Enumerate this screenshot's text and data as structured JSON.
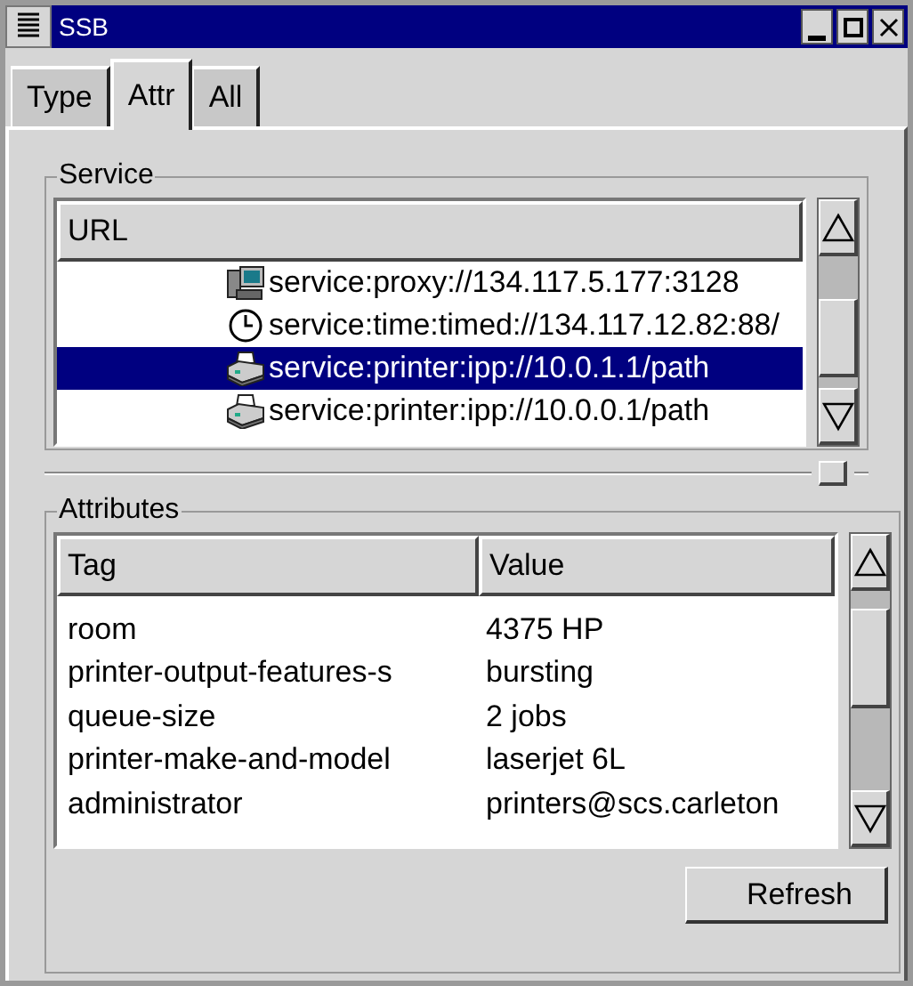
{
  "window": {
    "title": "SSB"
  },
  "tabs": [
    {
      "label": "Type",
      "selected": false
    },
    {
      "label": "Attr",
      "selected": true
    },
    {
      "label": "All",
      "selected": false
    }
  ],
  "service": {
    "title": "Service",
    "columns": [
      "URL"
    ],
    "rows": [
      {
        "kind": "proxy",
        "url": "service:proxy://134.117.5.177:3128",
        "selected": false
      },
      {
        "kind": "time",
        "url": "service:time:timed://134.117.12.82:88/",
        "selected": false
      },
      {
        "kind": "printer",
        "url": "service:printer:ipp://10.0.1.1/path",
        "selected": true
      },
      {
        "kind": "printer",
        "url": "service:printer:ipp://10.0.0.1/path",
        "selected": false
      }
    ]
  },
  "attributes": {
    "title": "Attributes",
    "columns": [
      "Tag",
      "Value"
    ],
    "rows": [
      {
        "tag": "room",
        "value": "4375 HP"
      },
      {
        "tag": "printer-output-features-s",
        "value": "bursting"
      },
      {
        "tag": "queue-size",
        "value": "2 jobs"
      },
      {
        "tag": "printer-make-and-model",
        "value": "laserjet 6L"
      },
      {
        "tag": "administrator",
        "value": "printers@scs.carleton"
      }
    ]
  },
  "buttons": [
    "Refresh"
  ]
}
